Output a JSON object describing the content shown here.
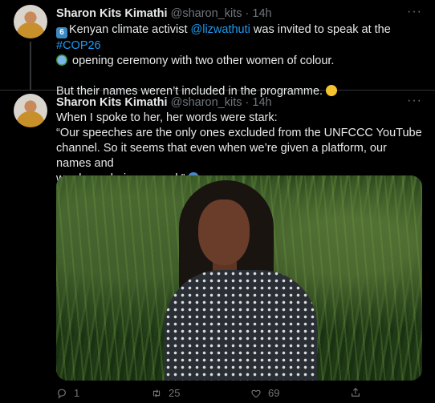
{
  "tweets": [
    {
      "author_name": "Sharon Kits Kimathi",
      "author_handle": "@sharon_kits",
      "separator": "·",
      "time": "14h",
      "more": "···",
      "line1_emoji": "6",
      "line1_a": "Kenyan climate activist ",
      "line1_mention": "@lizwathuti",
      "line1_b": " was invited to speak at the ",
      "line1_hashtag": "#COP26",
      "line2": " opening ceremony with two other women of colour.",
      "line3": "But their names weren’t included in the programme. "
    },
    {
      "author_name": "Sharon Kits Kimathi",
      "author_handle": "@sharon_kits",
      "separator": "·",
      "time": "14h",
      "more": "···",
      "text_line1": "When I spoke to her, her words were stark:",
      "text_line2": "“Our speeches are the only ones excluded from the UNFCCC YouTube",
      "text_line3": "channel. So it seems that even when we’re given a platform, our names and",
      "text_line4": "words are being erased.” ",
      "actions": {
        "reply_count": "1",
        "retweet_count": "25",
        "like_count": "69"
      }
    }
  ],
  "colors": {
    "background": "#000000",
    "text": "#e7e9ea",
    "secondary": "#71767b",
    "link": "#1d9bf0"
  },
  "icons": [
    "more-icon",
    "reply-icon",
    "retweet-icon",
    "like-icon",
    "share-icon"
  ]
}
